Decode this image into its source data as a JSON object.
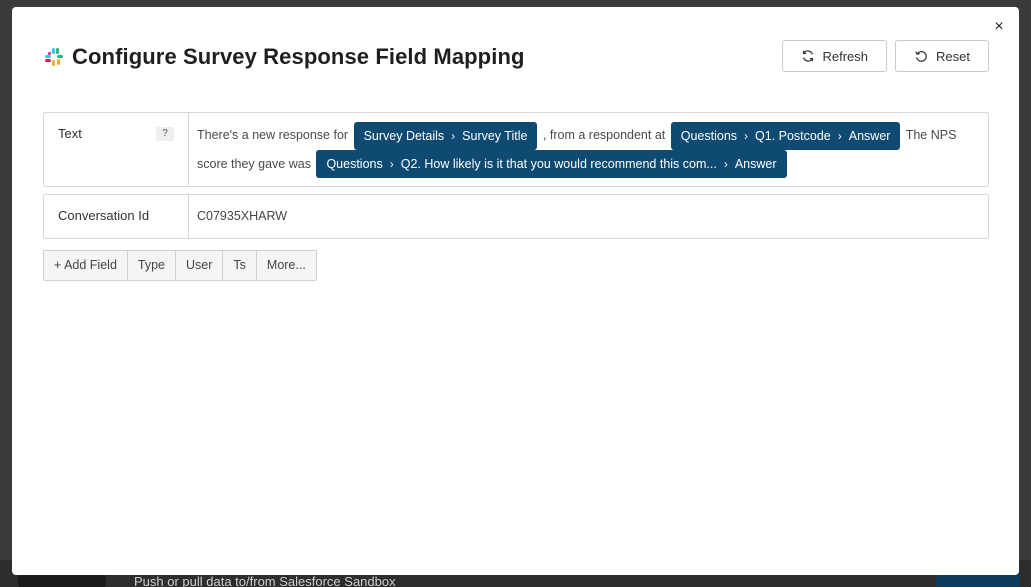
{
  "modal": {
    "title": "Configure Survey Response Field Mapping",
    "close_label": "×",
    "refresh_label": "Refresh",
    "reset_label": "Reset"
  },
  "fields": {
    "text": {
      "label": "Text",
      "help": "?",
      "seg1": "There's a new response for",
      "chip1": [
        "Survey Details",
        "Survey Title"
      ],
      "seg2": ", from a respondent at",
      "chip2": [
        "Questions",
        "Q1. Postcode",
        "Answer"
      ],
      "seg3": "The NPS score they gave was",
      "chip3": [
        "Questions",
        "Q2. How likely is it that you would recommend this com...",
        "Answer"
      ]
    },
    "conversation": {
      "label": "Conversation Id",
      "value": "C07935XHARW"
    }
  },
  "toolbar": {
    "add_field": "+ Add Field",
    "type": "Type",
    "user": "User",
    "ts": "Ts",
    "more": "More..."
  },
  "background": {
    "text": "Push or pull data to/from Salesforce Sandbox"
  },
  "colors": {
    "chip": "#0f4a73",
    "modal": "#ffffff",
    "backdrop": "#3a3a3a"
  },
  "icons": {
    "logo": "slack-logo-icon",
    "refresh": "refresh-icon",
    "reset": "reset-icon",
    "close": "close-icon",
    "chip_separator": "chevron-right-icon"
  }
}
